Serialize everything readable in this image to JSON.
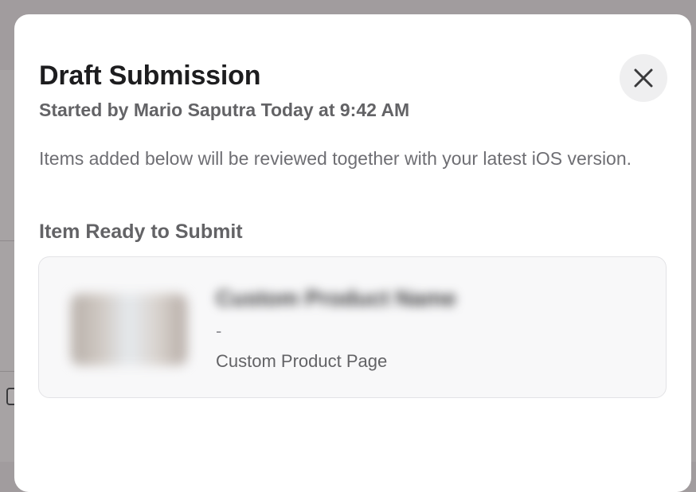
{
  "modal": {
    "title": "Draft Submission",
    "subtitle": "Started by Mario Saputra Today at 9:42 AM",
    "description": "Items added below will be reviewed together with your latest iOS version.",
    "close_icon": "close-icon"
  },
  "section": {
    "heading": "Item Ready to Submit"
  },
  "item": {
    "name": "Custom Product Name",
    "separator": "-",
    "type": "Custom Product Page"
  }
}
